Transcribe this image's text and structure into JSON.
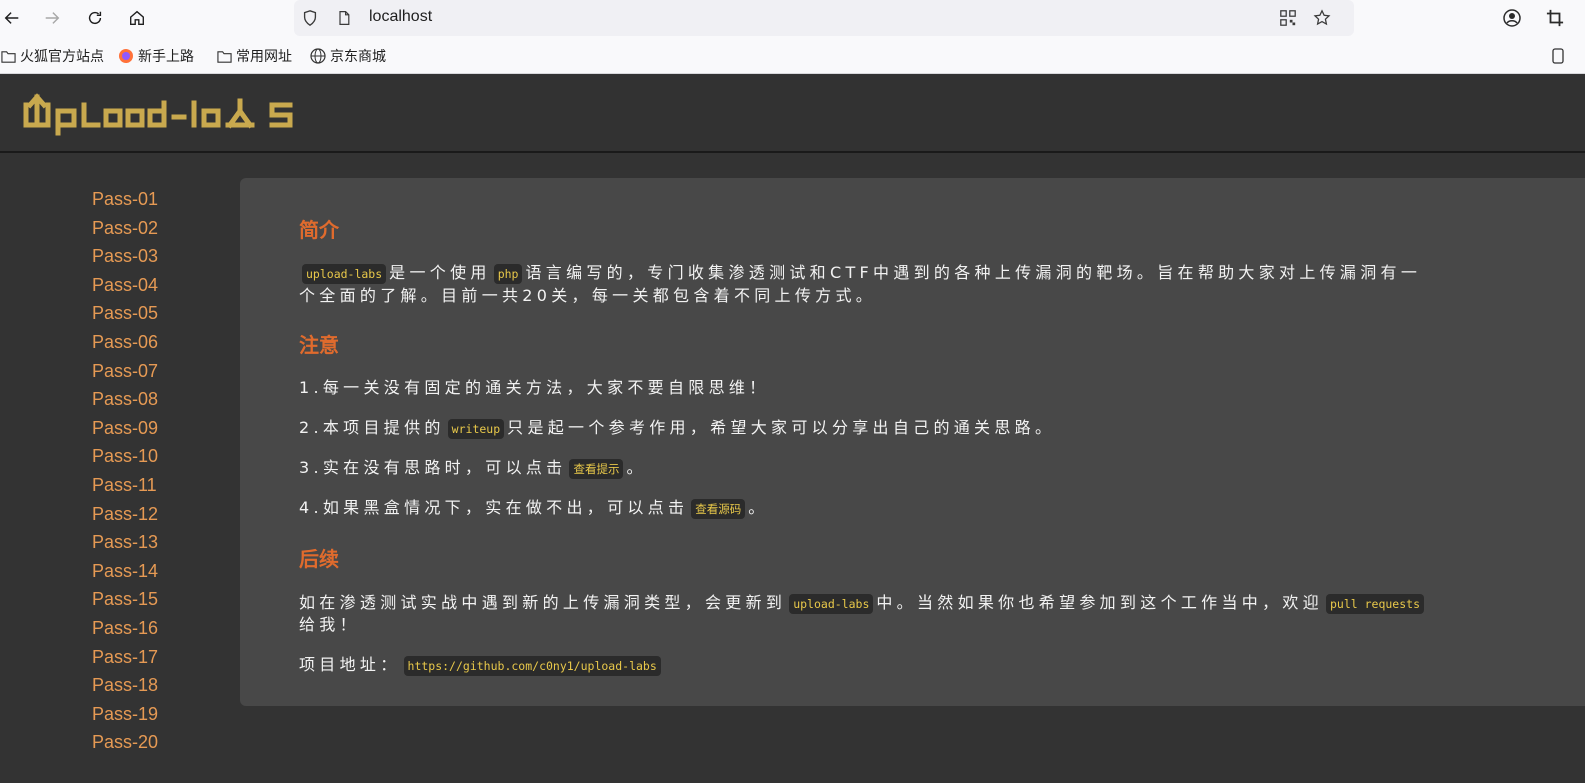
{
  "browser": {
    "url": "localhost",
    "bookmarks": [
      "火狐官方站点",
      "新手上路",
      "常用网址",
      "京东商城"
    ]
  },
  "site": {
    "logo_text": "UploadLabs"
  },
  "sidebar": {
    "items": [
      "Pass-01",
      "Pass-02",
      "Pass-03",
      "Pass-04",
      "Pass-05",
      "Pass-06",
      "Pass-07",
      "Pass-08",
      "Pass-09",
      "Pass-10",
      "Pass-11",
      "Pass-12",
      "Pass-13",
      "Pass-14",
      "Pass-15",
      "Pass-16",
      "Pass-17",
      "Pass-18",
      "Pass-19",
      "Pass-20"
    ]
  },
  "content": {
    "intro": {
      "title": "简介",
      "code1": "upload-labs",
      "t1": "是一个使用",
      "code2": "php",
      "t2": "语言编写的，专门收集渗透测试和CTF中遇到的各种上传漏洞的靶场。旨在帮助大家对上传漏洞有一",
      "t3": "个全面的了解。目前一共20关，每一关都包含着不同上传方式。"
    },
    "notes": {
      "title": "注意",
      "n1": "1.每一关没有固定的通关方法，大家不要自限思维！",
      "n2a": "2.本项目提供的",
      "n2code": "writeup",
      "n2b": "只是起一个参考作用，希望大家可以分享出自己的通关思路。",
      "n3a": "3.实在没有思路时，可以点击",
      "n3link": "查看提示",
      "n3b": "。",
      "n4a": "4.如果黑盒情况下，实在做不出，可以点击",
      "n4link": "查看源码",
      "n4b": "。"
    },
    "followup": {
      "title": "后续",
      "t1": "如在渗透测试实战中遇到新的上传漏洞类型，会更新到",
      "code1": "upload-labs",
      "t2": "中。当然如果你也希望参加到这个工作当中，欢迎",
      "code2": "pull requests",
      "t3": "给我！",
      "addr_label": "项目地址：",
      "addr_link": "https://github.com/c0ny1/upload-labs"
    }
  },
  "colors": {
    "accent_orange": "#e69a54",
    "heading_orange": "#e06b2d",
    "code_yellow": "#e8c84a",
    "logo_gold": "#c9a94e"
  }
}
